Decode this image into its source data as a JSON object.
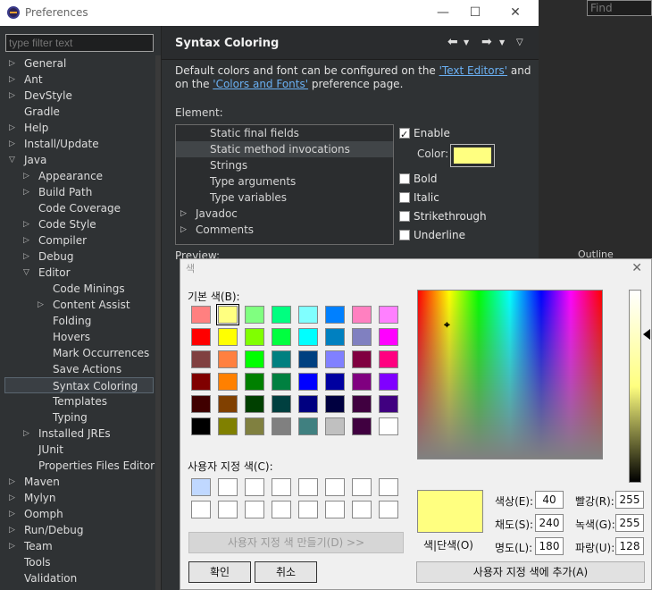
{
  "window": {
    "title": "Preferences",
    "minimize": "—",
    "maximize": "☐",
    "close": "✕"
  },
  "filter": {
    "placeholder": "type filter text"
  },
  "tree": [
    {
      "label": "General",
      "indent": 0,
      "arrow": true
    },
    {
      "label": "Ant",
      "indent": 0,
      "arrow": true
    },
    {
      "label": "DevStyle",
      "indent": 0,
      "arrow": true
    },
    {
      "label": "Gradle",
      "indent": 0,
      "arrow": false
    },
    {
      "label": "Help",
      "indent": 0,
      "arrow": true
    },
    {
      "label": "Install/Update",
      "indent": 0,
      "arrow": true
    },
    {
      "label": "Java",
      "indent": 0,
      "arrow": true,
      "open": true
    },
    {
      "label": "Appearance",
      "indent": 1,
      "arrow": true
    },
    {
      "label": "Build Path",
      "indent": 1,
      "arrow": true
    },
    {
      "label": "Code Coverage",
      "indent": 1,
      "arrow": false
    },
    {
      "label": "Code Style",
      "indent": 1,
      "arrow": true
    },
    {
      "label": "Compiler",
      "indent": 1,
      "arrow": true
    },
    {
      "label": "Debug",
      "indent": 1,
      "arrow": true
    },
    {
      "label": "Editor",
      "indent": 1,
      "arrow": true,
      "open": true
    },
    {
      "label": "Code Minings",
      "indent": 2,
      "arrow": false
    },
    {
      "label": "Content Assist",
      "indent": 2,
      "arrow": true
    },
    {
      "label": "Folding",
      "indent": 2,
      "arrow": false
    },
    {
      "label": "Hovers",
      "indent": 2,
      "arrow": false
    },
    {
      "label": "Mark Occurrences",
      "indent": 2,
      "arrow": false
    },
    {
      "label": "Save Actions",
      "indent": 2,
      "arrow": false
    },
    {
      "label": "Syntax Coloring",
      "indent": 2,
      "arrow": false,
      "selected": true
    },
    {
      "label": "Templates",
      "indent": 2,
      "arrow": false
    },
    {
      "label": "Typing",
      "indent": 2,
      "arrow": false
    },
    {
      "label": "Installed JREs",
      "indent": 1,
      "arrow": true
    },
    {
      "label": "JUnit",
      "indent": 1,
      "arrow": false
    },
    {
      "label": "Properties Files Editor",
      "indent": 1,
      "arrow": false
    },
    {
      "label": "Maven",
      "indent": 0,
      "arrow": true
    },
    {
      "label": "Mylyn",
      "indent": 0,
      "arrow": true
    },
    {
      "label": "Oomph",
      "indent": 0,
      "arrow": true
    },
    {
      "label": "Run/Debug",
      "indent": 0,
      "arrow": true
    },
    {
      "label": "Team",
      "indent": 0,
      "arrow": true
    },
    {
      "label": "Tools",
      "indent": 0,
      "arrow": false
    },
    {
      "label": "Validation",
      "indent": 0,
      "arrow": false
    }
  ],
  "page": {
    "heading": "Syntax Coloring",
    "desc_1": "Default colors and font can be configured on the ",
    "link_text_editors": "'Text Editors'",
    "desc_2": " and on the ",
    "link_colors_fonts": "'Colors and Fonts'",
    "desc_3": " preference page.",
    "element_label": "Element:",
    "preview_label": "Preview:"
  },
  "elements": [
    {
      "label": "Static final fields",
      "indent": 2,
      "arrow": false
    },
    {
      "label": "Static method invocations",
      "indent": 2,
      "arrow": false,
      "selected": true
    },
    {
      "label": "Strings",
      "indent": 2,
      "arrow": false
    },
    {
      "label": "Type arguments",
      "indent": 2,
      "arrow": false
    },
    {
      "label": "Type variables",
      "indent": 2,
      "arrow": false
    },
    {
      "label": "Javadoc",
      "indent": 1,
      "arrow": true
    },
    {
      "label": "Comments",
      "indent": 1,
      "arrow": true
    }
  ],
  "options": {
    "enable": "Enable",
    "color": "Color:",
    "bold": "Bold",
    "italic": "Italic",
    "strikethrough": "Strikethrough",
    "underline": "Underline"
  },
  "ide": {
    "find_placeholder": "Find",
    "outline": "Outline"
  },
  "color_dialog": {
    "title": "색",
    "basic_label": "기본 색(B):",
    "custom_label": "사용자 지정 색(C):",
    "define_button": "사용자 지정 색 만들기(D) >>",
    "ok": "확인",
    "cancel": "취소",
    "solid_label": "색|단색(O)",
    "add_button": "사용자 지정 색에 추가(A)",
    "hue_label": "색상(E):",
    "hue": "40",
    "sat_label": "채도(S):",
    "sat": "240",
    "lum_label": "명도(L):",
    "lum": "180",
    "red_label": "빨강(R):",
    "red": "255",
    "green_label": "녹색(G):",
    "green": "255",
    "blue_label": "파랑(U):",
    "blue": "128",
    "basic_colors": [
      "#ff8080",
      "#ffff80",
      "#80ff80",
      "#00ff80",
      "#80ffff",
      "#0080ff",
      "#ff80c0",
      "#ff80ff",
      "#ff0000",
      "#ffff00",
      "#80ff00",
      "#00ff40",
      "#00ffff",
      "#0080c0",
      "#8080c0",
      "#ff00ff",
      "#804040",
      "#ff8040",
      "#00ff00",
      "#008080",
      "#004080",
      "#8080ff",
      "#800040",
      "#ff0080",
      "#800000",
      "#ff8000",
      "#008000",
      "#008040",
      "#0000ff",
      "#0000a0",
      "#800080",
      "#8000ff",
      "#400000",
      "#804000",
      "#004000",
      "#004040",
      "#000080",
      "#000040",
      "#400040",
      "#400080",
      "#000000",
      "#808000",
      "#808040",
      "#808080",
      "#408080",
      "#c0c0c0",
      "#400040",
      "#ffffff"
    ],
    "custom_colors": [
      "#c0d8ff",
      "#ffffff",
      "#ffffff",
      "#ffffff",
      "#ffffff",
      "#ffffff",
      "#ffffff",
      "#ffffff",
      "#ffffff",
      "#ffffff",
      "#ffffff",
      "#ffffff",
      "#ffffff",
      "#ffffff",
      "#ffffff",
      "#ffffff"
    ],
    "selected_color": "#ffff80"
  }
}
